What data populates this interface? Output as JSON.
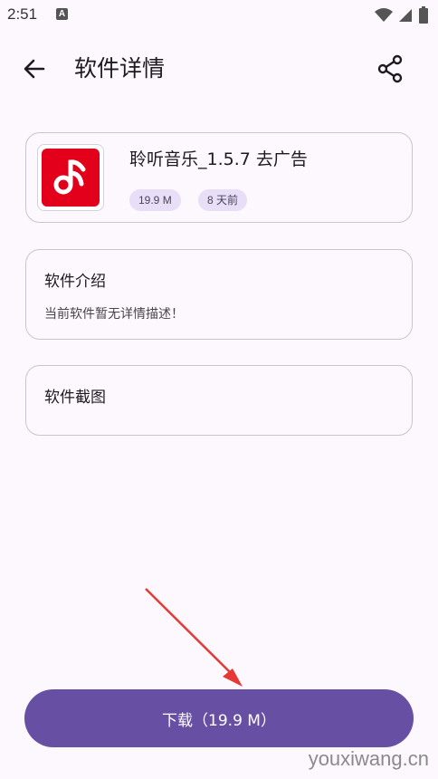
{
  "status_bar": {
    "time": "2:51",
    "notification_icon": "A"
  },
  "appbar": {
    "title": "软件详情",
    "back_icon": "arrow-left-icon",
    "share_icon": "share-icon"
  },
  "app": {
    "name": "聆听音乐_1.5.7 去广告",
    "size": "19.9 M",
    "updated": "8 天前",
    "icon_color": "#e3001b"
  },
  "intro": {
    "title": "软件介绍",
    "description": "当前软件暂无详情描述！"
  },
  "screenshots": {
    "title": "软件截图"
  },
  "download": {
    "label": "下载（19.9 M）"
  },
  "watermark": "youxiwang.cn",
  "colors": {
    "background": "#fdf7fe",
    "primary": "#6750a4",
    "chip": "#e8def8",
    "annotation_arrow": "#e53935"
  }
}
